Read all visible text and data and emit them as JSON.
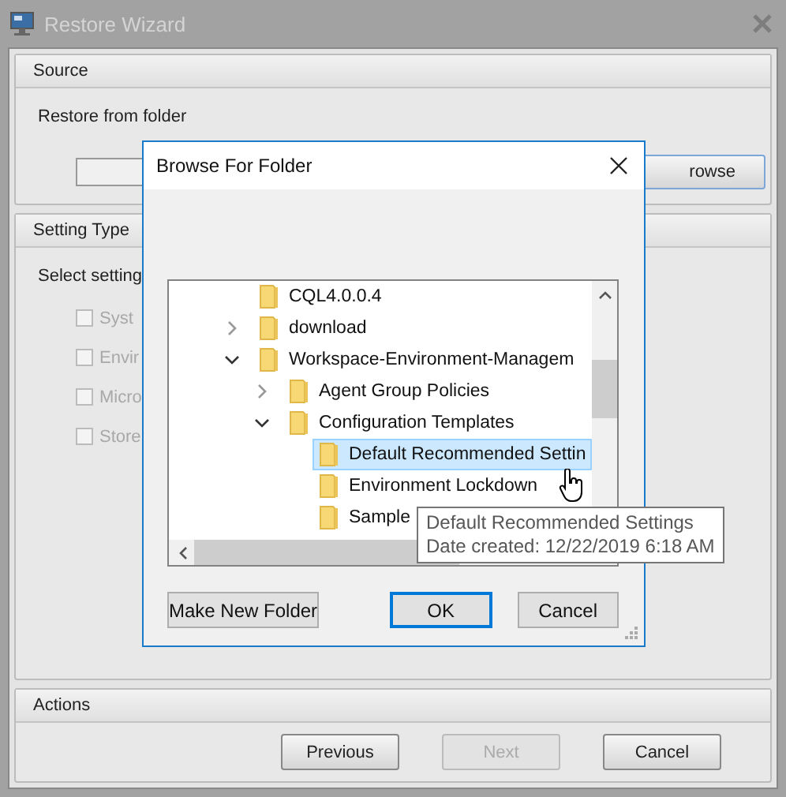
{
  "window": {
    "title": "Restore Wizard"
  },
  "source": {
    "header": "Source",
    "label": "Restore from folder",
    "browse_button": "rowse"
  },
  "setting_type": {
    "header": "Setting Type",
    "label": "Select setting",
    "options": [
      {
        "label": "Syst",
        "checked": false,
        "disabled": true
      },
      {
        "label": "Envir",
        "checked": false,
        "disabled": true
      },
      {
        "label": "Micro",
        "checked": false,
        "disabled": true
      },
      {
        "label": "Store",
        "checked": false,
        "disabled": true
      }
    ]
  },
  "actions": {
    "header": "Actions",
    "buttons": [
      {
        "label": "Previous",
        "disabled": false
      },
      {
        "label": "Next",
        "disabled": true
      },
      {
        "label": "Cancel",
        "disabled": false
      }
    ]
  },
  "dialog": {
    "title": "Browse For Folder",
    "tree": [
      {
        "label": "CQL4.0.0.4",
        "selected": false
      },
      {
        "label": "download",
        "expanded": false,
        "selected": false
      },
      {
        "label": "Workspace-Environment-Managem",
        "expanded": true,
        "selected": false,
        "children": [
          {
            "label": "Agent Group Policies",
            "expanded": false,
            "selected": false
          },
          {
            "label": "Configuration Templates",
            "expanded": true,
            "selected": false,
            "children": [
              {
                "label": "Default Recommended Settin",
                "selected": true
              },
              {
                "label": "Environment Lockdown",
                "selected": false
              },
              {
                "label": "Sample",
                "selected": false
              }
            ]
          }
        ]
      }
    ],
    "tooltip": {
      "title": "Default Recommended Settings",
      "detail": "Date created: 12/22/2019 6:18 AM"
    },
    "buttons": [
      {
        "label": "Make New Folder",
        "kind": "left",
        "focused": false
      },
      {
        "label": "OK",
        "kind": "right",
        "focused": true
      },
      {
        "label": "Cancel",
        "kind": "right",
        "focused": false
      }
    ]
  }
}
